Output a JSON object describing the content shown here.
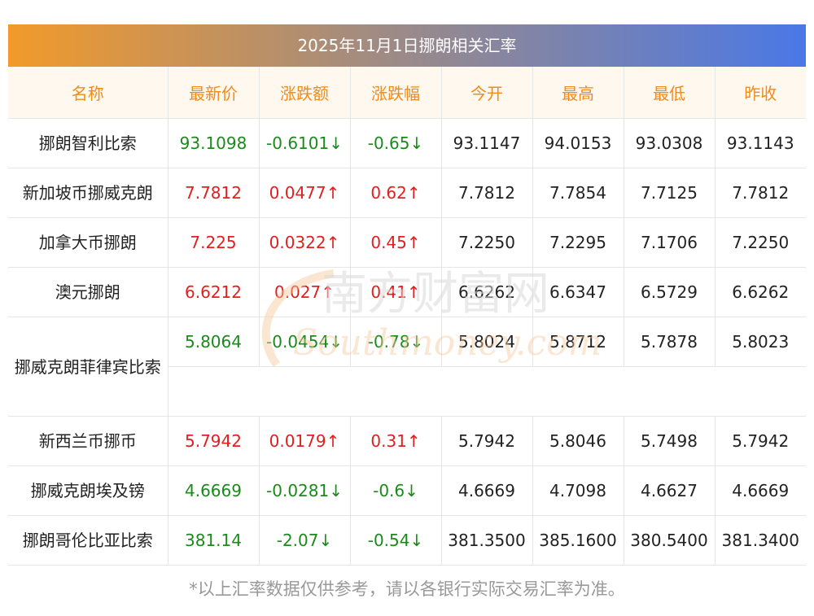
{
  "title": "2025年11月1日挪朗相关汇率",
  "headers": [
    "名称",
    "最新价",
    "涨跌额",
    "涨跌幅",
    "今开",
    "最高",
    "最低",
    "昨收"
  ],
  "rows": [
    {
      "name": "挪朗智利比索",
      "latest": "93.1098",
      "change": "-0.6101↓",
      "pct": "-0.65↓",
      "open": "93.1147",
      "high": "94.0153",
      "low": "93.0308",
      "prev": "93.1143",
      "dir": "down"
    },
    {
      "name": "新加坡币挪威克朗",
      "latest": "7.7812",
      "change": "0.0477↑",
      "pct": "0.62↑",
      "open": "7.7812",
      "high": "7.7854",
      "low": "7.7125",
      "prev": "7.7812",
      "dir": "up"
    },
    {
      "name": "加拿大币挪朗",
      "latest": "7.225",
      "change": "0.0322↑",
      "pct": "0.45↑",
      "open": "7.2250",
      "high": "7.2295",
      "low": "7.1706",
      "prev": "7.2250",
      "dir": "up"
    },
    {
      "name": "澳元挪朗",
      "latest": "6.6212",
      "change": "0.027↑",
      "pct": "0.41↑",
      "open": "6.6262",
      "high": "6.6347",
      "low": "6.5729",
      "prev": "6.6262",
      "dir": "up"
    },
    {
      "name": "挪威克朗菲律宾比索",
      "latest": "5.8064",
      "change": "-0.0454↓",
      "pct": "-0.78↓",
      "open": "5.8024",
      "high": "5.8712",
      "low": "5.7878",
      "prev": "5.8023",
      "dir": "down"
    },
    {
      "name": "新西兰币挪币",
      "latest": "5.7942",
      "change": "0.0179↑",
      "pct": "0.31↑",
      "open": "5.7942",
      "high": "5.8046",
      "low": "5.7498",
      "prev": "5.7942",
      "dir": "up"
    },
    {
      "name": "挪威克朗埃及镑",
      "latest": "4.6669",
      "change": "-0.0281↓",
      "pct": "-0.6↓",
      "open": "4.6669",
      "high": "4.7098",
      "low": "4.6627",
      "prev": "4.6669",
      "dir": "down"
    },
    {
      "name": "挪朗哥伦比亚比索",
      "latest": "381.14",
      "change": "-2.07↓",
      "pct": "-0.54↓",
      "open": "381.3500",
      "high": "385.1600",
      "low": "380.5400",
      "prev": "381.3400",
      "dir": "down"
    }
  ],
  "footer": "*以上汇率数据仅供参考，请以各银行实际交易汇率为准。",
  "watermark": {
    "cn": "南方财富网",
    "en": "Southmoney.com"
  },
  "colors": {
    "up": "#e02020",
    "down": "#1b8a1b",
    "header_text": "#f28a1a",
    "gradient_start": "#f29a2a",
    "gradient_end": "#4a78e6"
  }
}
